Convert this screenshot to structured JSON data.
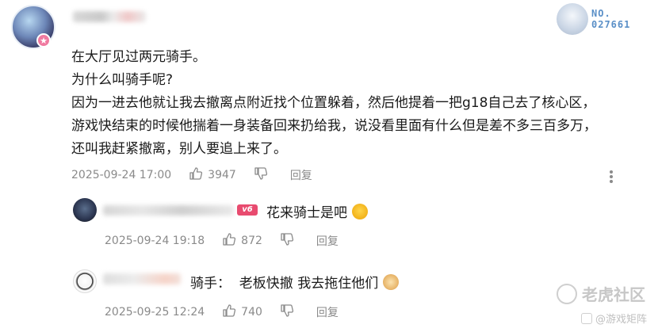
{
  "main_comment": {
    "lines": [
      "在大厅见过两元骑手。",
      "为什么叫骑手呢?",
      "因为一进去他就让我去撤离点附近找个位置躲着，然后他提着一把g18自己去了核心区，",
      "游戏快结束的时候他揣着一身装备回来扔给我，说没看里面有什么但是差不多三百多万，",
      "还叫我赶紧撤离，别人要追上来了。"
    ],
    "timestamp": "2025-09-24 17:00",
    "likes": "3947",
    "reply_label": "回复",
    "medal_line1": "NO.",
    "medal_line2": "027661"
  },
  "replies": [
    {
      "level_badge": "v6",
      "text": "花来骑士是吧",
      "timestamp": "2025-09-24 19:18",
      "likes": "872",
      "reply_label": "回复"
    },
    {
      "text": "骑手：  老板快撤 我去拖住他们",
      "timestamp": "2025-09-25 12:24",
      "likes": "740",
      "reply_label": "回复"
    }
  ],
  "watermarks": {
    "main": "老虎社区",
    "sub": "@游戏矩阵"
  },
  "colors": {
    "text": "#1a1a1a",
    "meta": "#8a8a8a",
    "level_badge": "#e84b6f",
    "medal_text": "#5a8fc7"
  }
}
